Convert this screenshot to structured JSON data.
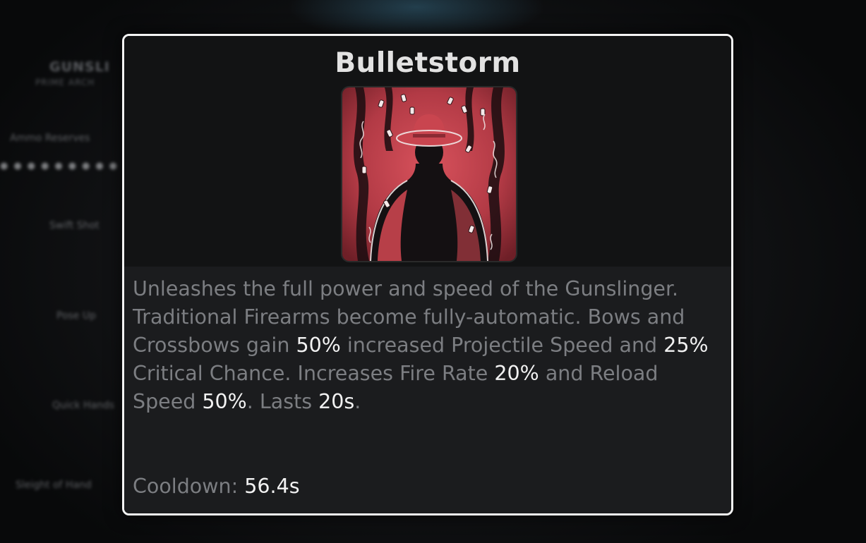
{
  "background": {
    "panel_title": "GUNSLI",
    "panel_subtitle": "PRIME ARCH",
    "skills": [
      "Ammo Reserves",
      "Swift Shot",
      "Pose Up",
      "Quick Hands",
      "Sleight of Hand"
    ]
  },
  "tooltip": {
    "title": "Bulletstorm",
    "icon": "gunslinger-silhouette-icon",
    "description": [
      {
        "text": "Unleashes the full power and speed of the Gunslinger. Traditional Firearms become fully-automatic. Bows and Crossbows gain ",
        "highlight": false
      },
      {
        "text": "50%",
        "highlight": true
      },
      {
        "text": " increased Projectile Speed and ",
        "highlight": false
      },
      {
        "text": "25%",
        "highlight": true
      },
      {
        "text": " Critical Chance. Increases Fire Rate ",
        "highlight": false
      },
      {
        "text": "20%",
        "highlight": true
      },
      {
        "text": " and Reload Speed ",
        "highlight": false
      },
      {
        "text": "50%",
        "highlight": true
      },
      {
        "text": ". Lasts ",
        "highlight": false
      },
      {
        "text": "20s",
        "highlight": true
      },
      {
        "text": ".",
        "highlight": false
      }
    ],
    "cooldown_label": "Cooldown:",
    "cooldown_value": "56.4s"
  },
  "colors": {
    "border": "#f4f4f4",
    "highlight_text": "#f2f2f2",
    "body_text": "#7c7e82",
    "icon_red": "#c9454f"
  }
}
